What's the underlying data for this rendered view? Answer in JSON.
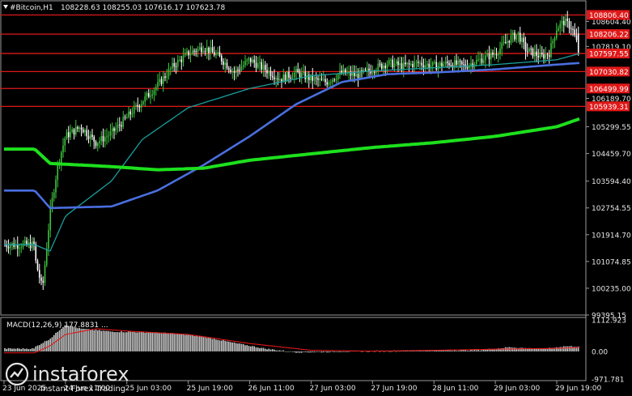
{
  "header": {
    "symbol": "#Bitcoin,H1",
    "ohlc": "108228.63 108255.03 107616.17 107623.78"
  },
  "macd": {
    "label": "MACD(12,26,9) 177.8831 ...",
    "ticks": [
      "1112.923",
      "0.00",
      "-971.781"
    ]
  },
  "price_axis_ticks": [
    "108604.40",
    "107819.10",
    "106189.70",
    "105299.55",
    "104459.70",
    "103594.40",
    "102754.55",
    "101914.70",
    "101074.85",
    "100235.00",
    "99395.15"
  ],
  "levels": [
    "108806.40",
    "108206.22",
    "107597.55",
    "107030.82",
    "106499.99",
    "105939.31"
  ],
  "time_axis": [
    "23 Jun 2025",
    "24 Jun 11:00",
    "25 Jun 03:00",
    "25 Jun 19:00",
    "26 Jun 11:00",
    "27 Jun 03:00",
    "27 Jun 19:00",
    "28 Jun 11:00",
    "29 Jun 03:00",
    "29 Jun 19:00"
  ],
  "watermark": {
    "brand": "instaforex",
    "tagline": "Instant Forex Trading"
  },
  "colors": {
    "background": "#000000",
    "candle_up": "#3ec43e",
    "candle_down": "#ffffff",
    "ma_fast": "#1a9e9e",
    "ma_mid": "#4a6fe0",
    "ma_slow": "#1de01d",
    "level": "#e01818",
    "macd_hist": "#c8c8c8",
    "macd_signal": "#e01818"
  },
  "chart_data": {
    "type": "candlestick",
    "instrument": "#Bitcoin",
    "timeframe": "H1",
    "y_range": [
      99395.15,
      109250
    ],
    "current": {
      "open": 108228.63,
      "high": 108255.03,
      "low": 107616.17,
      "close": 107623.78
    },
    "horizontal_levels": [
      108806.4,
      108206.22,
      107597.55,
      107030.82,
      106499.99,
      105939.31
    ],
    "close_path": [
      {
        "x": "23 Jun 2025",
        "y": 101600
      },
      {
        "x": "23 Jun 2025",
        "y": 102000
      },
      {
        "x": "24 Jun 03:00",
        "y": 101200
      },
      {
        "x": "24 Jun 05:00",
        "y": 100200
      },
      {
        "x": "24 Jun 07:00",
        "y": 102600
      },
      {
        "x": "24 Jun 09:00",
        "y": 104100
      },
      {
        "x": "24 Jun 11:00",
        "y": 105000
      },
      {
        "x": "24 Jun 15:00",
        "y": 105300
      },
      {
        "x": "24 Jun 19:00",
        "y": 104800
      },
      {
        "x": "24 Jun 23:00",
        "y": 105100
      },
      {
        "x": "25 Jun 03:00",
        "y": 105600
      },
      {
        "x": "25 Jun 07:00",
        "y": 106100
      },
      {
        "x": "25 Jun 11:00",
        "y": 106600
      },
      {
        "x": "25 Jun 15:00",
        "y": 107200
      },
      {
        "x": "25 Jun 19:00",
        "y": 107600
      },
      {
        "x": "25 Jun 23:00",
        "y": 107800
      },
      {
        "x": "26 Jun 03:00",
        "y": 107500
      },
      {
        "x": "26 Jun 07:00",
        "y": 107000
      },
      {
        "x": "26 Jun 11:00",
        "y": 107400
      },
      {
        "x": "26 Jun 15:00",
        "y": 107100
      },
      {
        "x": "26 Jun 19:00",
        "y": 106800
      },
      {
        "x": "26 Jun 23:00",
        "y": 107000
      },
      {
        "x": "27 Jun 03:00",
        "y": 106800
      },
      {
        "x": "27 Jun 07:00",
        "y": 106700
      },
      {
        "x": "27 Jun 11:00",
        "y": 107000
      },
      {
        "x": "27 Jun 15:00",
        "y": 106900
      },
      {
        "x": "27 Jun 19:00",
        "y": 107100
      },
      {
        "x": "27 Jun 23:00",
        "y": 107300
      },
      {
        "x": "28 Jun 03:00",
        "y": 107200
      },
      {
        "x": "28 Jun 07:00",
        "y": 107300
      },
      {
        "x": "28 Jun 11:00",
        "y": 107200
      },
      {
        "x": "28 Jun 15:00",
        "y": 107300
      },
      {
        "x": "28 Jun 19:00",
        "y": 107200
      },
      {
        "x": "28 Jun 23:00",
        "y": 107400
      },
      {
        "x": "29 Jun 03:00",
        "y": 107600
      },
      {
        "x": "29 Jun 07:00",
        "y": 108100
      },
      {
        "x": "29 Jun 09:00",
        "y": 108200
      },
      {
        "x": "29 Jun 11:00",
        "y": 107700
      },
      {
        "x": "29 Jun 15:00",
        "y": 107500
      },
      {
        "x": "29 Jun 17:00",
        "y": 107600
      },
      {
        "x": "29 Jun 19:00",
        "y": 108400
      },
      {
        "x": "29 Jun 21:00",
        "y": 108600
      },
      {
        "x": "29 Jun 23:00",
        "y": 108400
      },
      {
        "x": "30 Jun 01:00",
        "y": 107624
      }
    ],
    "moving_averages": [
      {
        "points": [
          {
            "x": "23 Jun 2025",
            "y": 101600
          },
          {
            "x": "24 Jun 07:00",
            "y": 101400
          },
          {
            "x": "24 Jun 11:00",
            "y": 102500
          },
          {
            "x": "24 Jun 23:00",
            "y": 103600
          },
          {
            "x": "25 Jun 07:00",
            "y": 104900
          },
          {
            "x": "25 Jun 19:00",
            "y": 105900
          },
          {
            "x": "26 Jun 11:00",
            "y": 106500
          },
          {
            "x": "27 Jun 03:00",
            "y": 106900
          },
          {
            "x": "27 Jun 19:00",
            "y": 107050
          },
          {
            "x": "28 Jun 11:00",
            "y": 107150
          },
          {
            "x": "29 Jun 03:00",
            "y": 107250
          },
          {
            "x": "29 Jun 19:00",
            "y": 107400
          },
          {
            "x": "30 Jun 01:00",
            "y": 107600
          }
        ]
      },
      {
        "points": [
          {
            "x": "23 Jun 2025",
            "y": 103300
          },
          {
            "x": "24 Jun 07:00",
            "y": 102750
          },
          {
            "x": "24 Jun 23:00",
            "y": 102800
          },
          {
            "x": "25 Jun 11:00",
            "y": 103300
          },
          {
            "x": "25 Jun 23:00",
            "y": 104100
          },
          {
            "x": "26 Jun 11:00",
            "y": 105000
          },
          {
            "x": "26 Jun 23:00",
            "y": 106000
          },
          {
            "x": "27 Jun 11:00",
            "y": 106700
          },
          {
            "x": "27 Jun 23:00",
            "y": 106950
          },
          {
            "x": "28 Jun 11:00",
            "y": 107000
          },
          {
            "x": "29 Jun 03:00",
            "y": 107100
          },
          {
            "x": "29 Jun 19:00",
            "y": 107250
          },
          {
            "x": "30 Jun 01:00",
            "y": 107300
          }
        ]
      },
      {
        "points": [
          {
            "x": "23 Jun 2025",
            "y": 104600
          },
          {
            "x": "24 Jun 07:00",
            "y": 104150
          },
          {
            "x": "24 Jun 23:00",
            "y": 104050
          },
          {
            "x": "25 Jun 11:00",
            "y": 103950
          },
          {
            "x": "25 Jun 23:00",
            "y": 104000
          },
          {
            "x": "26 Jun 11:00",
            "y": 104250
          },
          {
            "x": "27 Jun 03:00",
            "y": 104450
          },
          {
            "x": "27 Jun 19:00",
            "y": 104650
          },
          {
            "x": "28 Jun 11:00",
            "y": 104800
          },
          {
            "x": "29 Jun 03:00",
            "y": 105000
          },
          {
            "x": "29 Jun 19:00",
            "y": 105300
          },
          {
            "x": "30 Jun 01:00",
            "y": 105550
          }
        ]
      }
    ],
    "macd_range": [
      -971.781,
      1112.923
    ],
    "macd_histogram": [
      {
        "x": "23 Jun 2025",
        "y": 100
      },
      {
        "x": "24 Jun 03:00",
        "y": 150
      },
      {
        "x": "24 Jun 07:00",
        "y": 450
      },
      {
        "x": "24 Jun 11:00",
        "y": 950
      },
      {
        "x": "24 Jun 15:00",
        "y": 800
      },
      {
        "x": "24 Jun 23:00",
        "y": 700
      },
      {
        "x": "25 Jun 07:00",
        "y": 680
      },
      {
        "x": "25 Jun 15:00",
        "y": 640
      },
      {
        "x": "25 Jun 23:00",
        "y": 520
      },
      {
        "x": "26 Jun 07:00",
        "y": 300
      },
      {
        "x": "26 Jun 15:00",
        "y": 100
      },
      {
        "x": "26 Jun 23:00",
        "y": -30
      },
      {
        "x": "27 Jun 07:00",
        "y": -20
      },
      {
        "x": "27 Jun 15:00",
        "y": 10
      },
      {
        "x": "27 Jun 23:00",
        "y": 20
      },
      {
        "x": "28 Jun 07:00",
        "y": 30
      },
      {
        "x": "28 Jun 15:00",
        "y": 40
      },
      {
        "x": "28 Jun 23:00",
        "y": 50
      },
      {
        "x": "29 Jun 07:00",
        "y": 150
      },
      {
        "x": "29 Jun 15:00",
        "y": 80
      },
      {
        "x": "29 Jun 21:00",
        "y": 180
      },
      {
        "x": "30 Jun 01:00",
        "y": 178
      }
    ],
    "macd_signal": [
      {
        "x": "23 Jun 2025",
        "y": -50
      },
      {
        "x": "24 Jun 07:00",
        "y": 200
      },
      {
        "x": "24 Jun 11:00",
        "y": 600
      },
      {
        "x": "24 Jun 19:00",
        "y": 800
      },
      {
        "x": "25 Jun 03:00",
        "y": 720
      },
      {
        "x": "25 Jun 19:00",
        "y": 600
      },
      {
        "x": "26 Jun 11:00",
        "y": 280
      },
      {
        "x": "27 Jun 03:00",
        "y": 40
      },
      {
        "x": "27 Jun 19:00",
        "y": 10
      },
      {
        "x": "28 Jun 11:00",
        "y": 40
      },
      {
        "x": "29 Jun 03:00",
        "y": 80
      },
      {
        "x": "29 Jun 19:00",
        "y": 110
      },
      {
        "x": "30 Jun 01:00",
        "y": 140
      }
    ]
  }
}
